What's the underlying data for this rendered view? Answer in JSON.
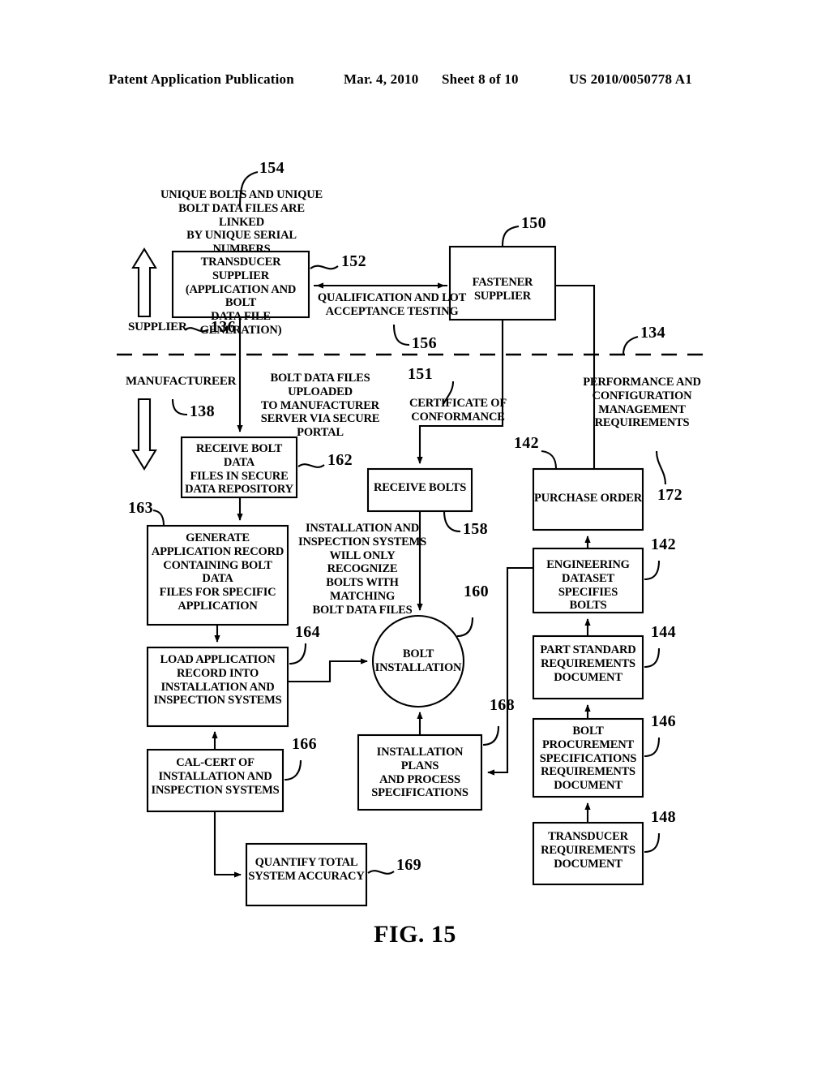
{
  "header": {
    "publication": "Patent Application Publication",
    "date": "Mar. 4, 2010",
    "sheet": "Sheet 8 of 10",
    "patent_number": "US 2010/0050778 A1"
  },
  "figure": {
    "caption": "FIG. 15",
    "divider_label": "134",
    "zones": {
      "supplier": "SUPPLIER",
      "supplier_ref": "136",
      "manufacturer": "MANUFACTUREER",
      "manufacturer_ref": "138"
    }
  },
  "nodes": {
    "unique_bolts_note": {
      "text": "UNIQUE BOLTS AND UNIQUE\nBOLT DATA FILES ARE LINKED\nBY UNIQUE SERIAL NUMBERS",
      "ref": "154"
    },
    "transducer_supplier": {
      "text": "TRANSDUCER SUPPLIER\n(APPLICATION AND BOLT\nDATA FILE GENERATION)",
      "ref": "152"
    },
    "fastener_supplier": {
      "text": "FASTENER SUPPLIER",
      "ref": "150"
    },
    "qualification_testing": {
      "text": "QUALIFICATION AND LOT\nACCEPTANCE TESTING",
      "ref": "156"
    },
    "bolt_data_upload": {
      "text": "BOLT DATA FILES UPLOADED\nTO MANUFACTURER\nSERVER VIA SECURE PORTAL"
    },
    "certificate_of_conformance": {
      "text": "CERTIFICATE OF\nCONFORMANCE",
      "ref": "151"
    },
    "performance_config_req": {
      "text": "PERFORMANCE AND\nCONFIGURATION\nMANAGEMENT\nREQUIREMENTS",
      "ref": "172"
    },
    "receive_bolt_data": {
      "text": "RECEIVE BOLT DATA\nFILES IN SECURE\nDATA REPOSITORY",
      "ref": "162"
    },
    "receive_bolts": {
      "text": "RECEIVE BOLTS",
      "ref": "158"
    },
    "purchase_order": {
      "text": "PURCHASE ORDER",
      "ref": "142"
    },
    "generate_application_record": {
      "text": "GENERATE\nAPPLICATION RECORD\nCONTAINING BOLT DATA\nFILES FOR SPECIFIC\nAPPLICATION",
      "ref": "163"
    },
    "installation_inspection_note": {
      "text": "INSTALLATION AND\nINSPECTION SYSTEMS\nWILL ONLY RECOGNIZE\nBOLTS WITH MATCHING\nBOLT DATA FILES"
    },
    "engineering_dataset": {
      "text": "ENGINEERING\nDATASET SPECIFIES\nBOLTS",
      "ref": "142"
    },
    "load_application_record": {
      "text": "LOAD APPLICATION\nRECORD INTO\nINSTALLATION AND\nINSPECTION SYSTEMS",
      "ref": "164"
    },
    "bolt_installation": {
      "text": "BOLT\nINSTALLATION",
      "ref": "160"
    },
    "part_standard_req": {
      "text": "PART STANDARD\nREQUIREMENTS\nDOCUMENT",
      "ref": "144"
    },
    "cal_cert": {
      "text": "CAL-CERT OF\nINSTALLATION AND\nINSPECTION SYSTEMS",
      "ref": "166"
    },
    "installation_plans": {
      "text": "INSTALLATION PLANS\nAND PROCESS\nSPECIFICATIONS",
      "ref": "168"
    },
    "bolt_procurement": {
      "text": "BOLT PROCUREMENT\nSPECIFICATIONS\nREQUIREMENTS\nDOCUMENT",
      "ref": "146"
    },
    "transducer_req": {
      "text": "TRANSDUCER\nREQUIREMENTS\nDOCUMENT",
      "ref": "148"
    },
    "quantify_accuracy": {
      "text": "QUANTIFY TOTAL\nSYSTEM ACCURACY",
      "ref": "169"
    }
  }
}
